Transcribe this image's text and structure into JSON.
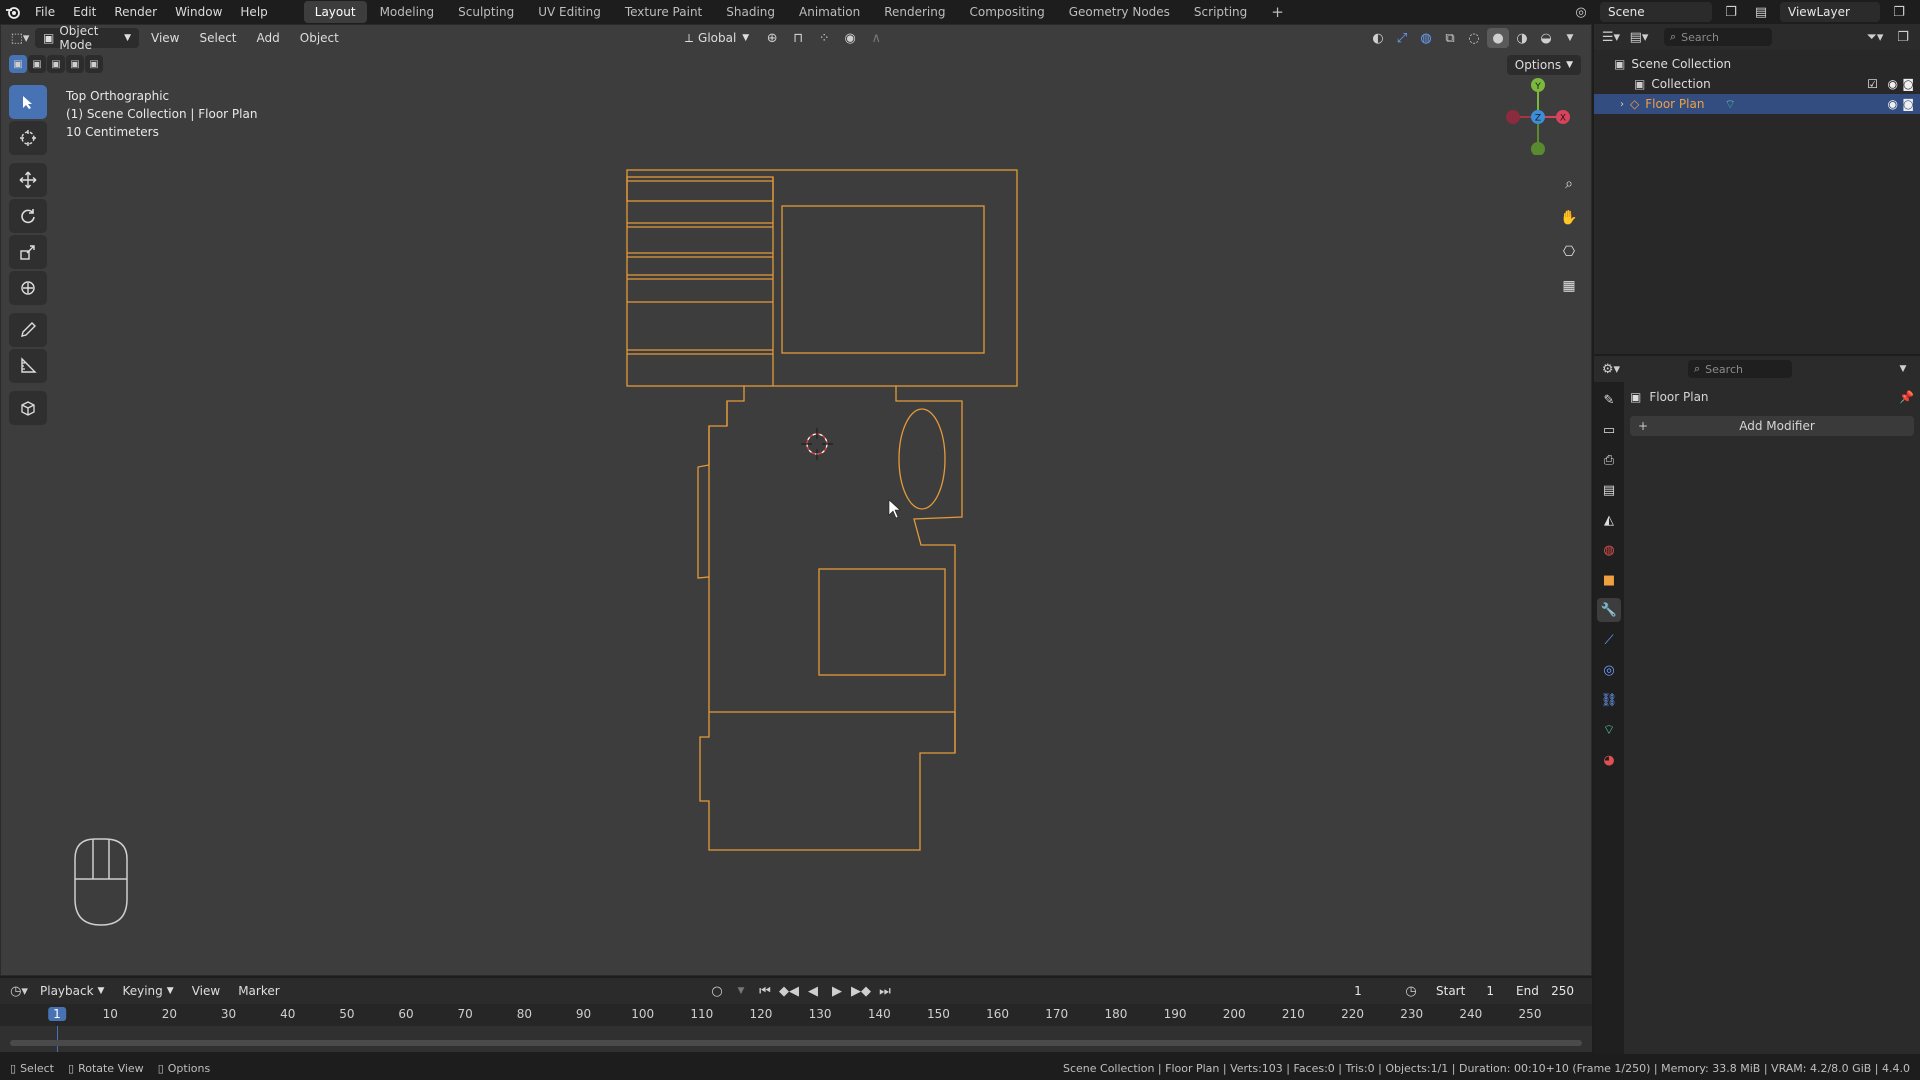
{
  "menu": [
    "File",
    "Edit",
    "Render",
    "Window",
    "Help"
  ],
  "workspaces": [
    "Layout",
    "Modeling",
    "Sculpting",
    "UV Editing",
    "Texture Paint",
    "Shading",
    "Animation",
    "Rendering",
    "Compositing",
    "Geometry Nodes",
    "Scripting"
  ],
  "active_workspace": "Layout",
  "scene": {
    "name": "Scene",
    "view_layer": "ViewLayer"
  },
  "viewport": {
    "mode": "Object Mode",
    "menus": [
      "View",
      "Select",
      "Add",
      "Object"
    ],
    "transform_orientation": "Global",
    "options_label": "Options",
    "overlay_lines": [
      "Top Orthographic",
      "(1) Scene Collection | Floor Plan",
      "10 Centimeters"
    ],
    "wire_color": "#e49a3a"
  },
  "outliner": {
    "search_placeholder": "Search",
    "items": [
      {
        "label": "Scene Collection"
      },
      {
        "label": "Collection"
      },
      {
        "label": "Floor Plan"
      }
    ]
  },
  "properties": {
    "search_placeholder": "Search",
    "object_name": "Floor Plan",
    "add_modifier": "Add Modifier"
  },
  "timeline": {
    "menus": [
      "Playback",
      "Keying",
      "View",
      "Marker"
    ],
    "current_frame": "1",
    "start_label": "Start",
    "start": "1",
    "end_label": "End",
    "end": "250",
    "ticks": [
      "1",
      "10",
      "20",
      "30",
      "40",
      "50",
      "60",
      "70",
      "80",
      "90",
      "100",
      "110",
      "120",
      "130",
      "140",
      "150",
      "160",
      "170",
      "180",
      "190",
      "200",
      "210",
      "220",
      "230",
      "240",
      "250"
    ]
  },
  "status": {
    "hints": [
      "Select",
      "Rotate View",
      "Options"
    ],
    "info": "Scene Collection | Floor Plan | Verts:103 | Faces:0 | Tris:0 | Objects:1/1 | Duration: 00:10+10 (Frame 1/250) | Memory: 33.8 MiB | VRAM: 4.2/8.0 GiB | 4.4.0"
  }
}
